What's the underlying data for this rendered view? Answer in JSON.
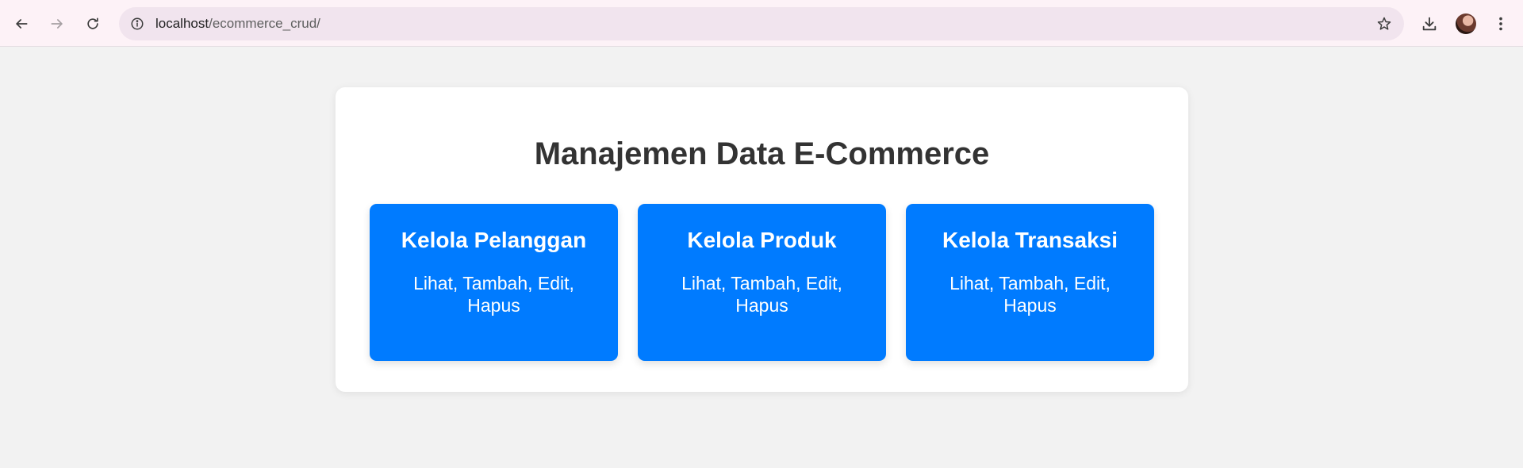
{
  "browser": {
    "url_host": "localhost",
    "url_path": "/ecommerce_crud/",
    "icons": {
      "back": "back-arrow-icon",
      "forward": "forward-arrow-icon",
      "reload": "reload-icon",
      "site_info": "site-info-icon",
      "bookmark": "star-icon",
      "downloads": "download-icon",
      "menu": "more-vert-icon"
    }
  },
  "page": {
    "title": "Manajemen Data E-Commerce",
    "cards": [
      {
        "title": "Kelola Pelanggan",
        "description": "Lihat, Tambah, Edit, Hapus"
      },
      {
        "title": "Kelola Produk",
        "description": "Lihat, Tambah, Edit, Hapus"
      },
      {
        "title": "Kelola Transaksi",
        "description": "Lihat, Tambah, Edit, Hapus"
      }
    ]
  },
  "colors": {
    "card_blue": "#007bff",
    "page_bg": "#f2f2f2",
    "title_text": "#333333"
  }
}
